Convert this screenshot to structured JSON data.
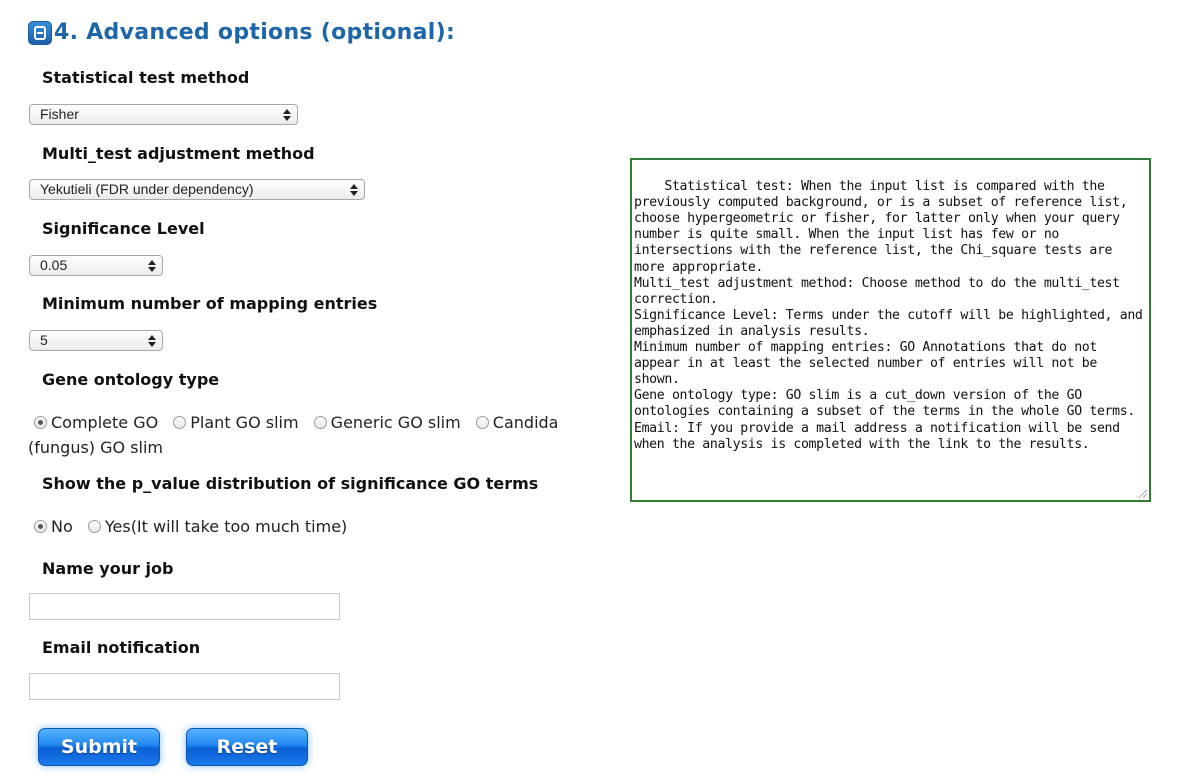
{
  "section": {
    "title": "4. Advanced options (optional):"
  },
  "statistical_test": {
    "label": "Statistical test method",
    "selected": "Fisher"
  },
  "multi_test": {
    "label": "Multi_test adjustment method",
    "selected": "Yekutieli (FDR under dependency)"
  },
  "significance": {
    "label": "Significance Level",
    "selected": "0.05"
  },
  "min_entries": {
    "label": "Minimum number of mapping entries",
    "selected": "5"
  },
  "ontology": {
    "label": "Gene ontology type",
    "options": [
      "Complete GO",
      "Plant GO slim",
      "Generic GO slim",
      "Candida",
      "(fungus) GO slim"
    ],
    "selected": "Complete GO"
  },
  "pvalue": {
    "label": "Show the p_value distribution of significance GO terms",
    "options": [
      "No",
      "Yes(It will take too much time)"
    ],
    "selected": "No"
  },
  "job": {
    "label": "Name your job",
    "value": ""
  },
  "email": {
    "label": "Email notification",
    "value": ""
  },
  "buttons": {
    "submit": "Submit",
    "reset": "Reset"
  },
  "help_text": "Statistical test: When the input list is compared with the previously computed background, or is a subset of reference list, choose hypergeometric or fisher, for latter only when your query number is quite small. When the input list has few or no intersections with the reference list, the Chi_square tests are more appropriate.\nMulti_test adjustment method: Choose method to do the multi_test correction.\nSignificance Level: Terms under the cutoff will be highlighted, and emphasized in analysis results.\nMinimum number of mapping entries: GO Annotations that do not appear in at least the selected number of entries will not be shown.\nGene ontology type: GO slim is a cut_down version of the GO ontologies containing a subset of the terms in the whole GO terms.\nEmail: If you provide a mail address a notification will be send when the analysis is completed with the link to the results.",
  "colors": {
    "title": "#1e66aa",
    "help_border": "#2e7d32",
    "button": "#1e86ef"
  }
}
